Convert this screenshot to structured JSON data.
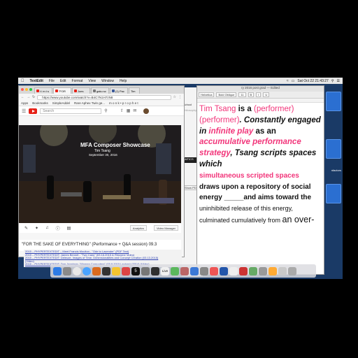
{
  "menubar": {
    "apple": "",
    "app": "TextEdit",
    "items": [
      "File",
      "Edit",
      "Format",
      "View",
      "Window",
      "Help"
    ],
    "clock": "Sat Oct 22  21:43:27"
  },
  "browser": {
    "tabs": [
      {
        "label": "t i m t s",
        "icon": "youtube"
      },
      {
        "label": "\"FOR",
        "icon": "youtube"
      },
      {
        "label": "Joes",
        "icon": "youtube"
      },
      {
        "label": "gaku sc",
        "icon": "generic"
      },
      {
        "label": "(1) Pac",
        "icon": "facebook"
      },
      {
        "label": "Tim",
        "icon": "generic"
      }
    ],
    "url": "https://www.youtube.com/watch?v=B4C7N1H7zN8",
    "bookmarks": [
      "Apps",
      "Bookmarks",
      "SimpleAddel",
      "Rare Aphex Twin ge...",
      "m o n k • p r o p h e t"
    ],
    "search_placeholder": "Search",
    "video": {
      "title": "MFA Composer Showcase",
      "line1": "Tim Tsang",
      "line2": "September 30, 2016"
    },
    "controls": {
      "analytics": "Analytics",
      "video_manager": "Video Manager"
    },
    "video_title_text": "\"FOR THE SAKE OF EVERYTHING\" (Performance + Q&A session) 09.3"
  },
  "middle": {
    "label1": "School",
    "label2": "philosophy",
    "label3": "ANTICS",
    "label4": "Show PD"
  },
  "links": [
    "2015 – PHYPERTEXTEDIT – Meet Francis Moulton - \"Ode to Lavender\" (PDF Text)",
    "2015 – PHYPERTEXTEDIT: James Bennet - \"Two Cans\" (03.16.2015 & Rhizome Video)",
    "2015 – PHYPERTEXTEDIT: Deleuze, Images of Time, Dimensionalities and Concept Creation (03.13.2015)",
    "(Video)",
    "2015 – PHYPERTEXTEDIT: Tom Jennings: \"Women Computers\" (03.9.2015 Lecture) (2014) (Video)"
  ],
  "textedit": {
    "title": "ry 2016 post grad — Edited",
    "toolbar": [
      "Helvetica",
      "Bold Oblique",
      "11",
      "B",
      "I",
      "U"
    ],
    "body": {
      "s1": "Tim Tsang",
      "s2": " is a ",
      "s3": "(performer)",
      "s4": "(performer)",
      "s5": ". Constantly engaged in ",
      "s6": "infinite play",
      "s7": " as an ",
      "s8": "accumulative performance strategy",
      "s9": ", Tsang scripts spaces which ",
      "s10": "simultaneous scripted spaces",
      "s11": "draws upon a repository of social energy _____and aims toward the ",
      "s12": "uninhibited release of this energy, culminated cumulatively from ",
      "s13": "an over-"
    }
  },
  "desktop": {
    "side_label": "nfactors"
  },
  "dock": {
    "calendar_day": "5",
    "live_label": "Live"
  },
  "colors": {
    "pink": "#f2357a",
    "youtube_red": "#e62117",
    "desktop_blue": "#1a3a66"
  }
}
